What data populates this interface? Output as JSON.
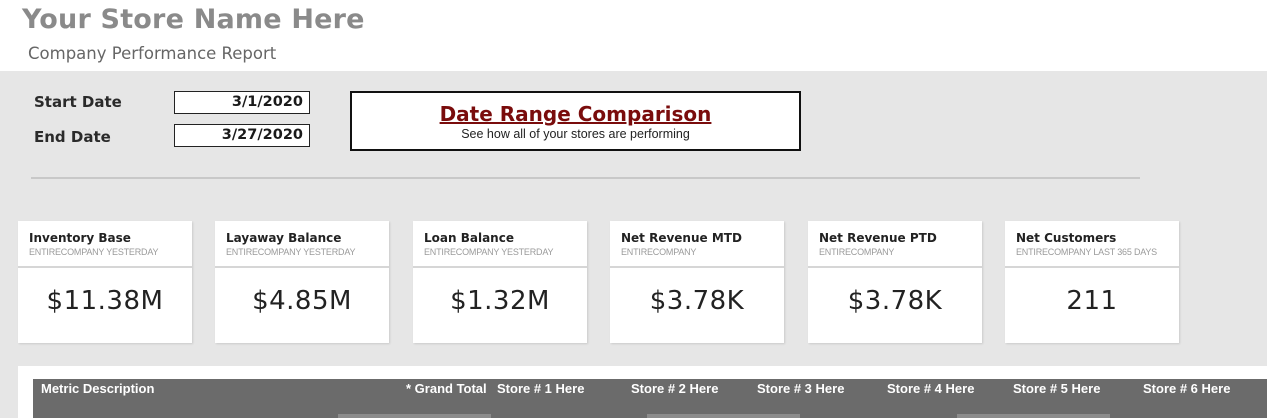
{
  "header": {
    "store_name": "Your Store Name Here",
    "report_subtitle": "Company Performance Report"
  },
  "dates": {
    "start_label": "Start Date",
    "start_value": "3/1/2020",
    "end_label": "End Date",
    "end_value": "3/27/2020"
  },
  "comparison": {
    "title": "Date Range Comparison",
    "subtitle": "See how all of your stores are performing"
  },
  "kpis": [
    {
      "title": "Inventory Base",
      "sub": "ENTIRECOMPANY YESTERDAY",
      "value": "$11.38M"
    },
    {
      "title": "Layaway Balance",
      "sub": "ENTIRECOMPANY YESTERDAY",
      "value": "$4.85M"
    },
    {
      "title": "Loan Balance",
      "sub": "ENTIRECOMPANY YESTERDAY",
      "value": "$1.32M"
    },
    {
      "title": "Net Revenue MTD",
      "sub": "ENTIRECOMPANY",
      "value": "$3.78K"
    },
    {
      "title": "Net Revenue PTD",
      "sub": "ENTIRECOMPANY",
      "value": "$3.78K"
    },
    {
      "title": "Net Customers",
      "sub": "ENTIRECOMPANY LAST 365 DAYS",
      "value": "211"
    }
  ],
  "table": {
    "columns": [
      "Metric Description",
      "* Grand Total",
      "Store # 1 Here",
      "Store # 2 Here",
      "Store # 3 Here",
      "Store # 4 Here",
      "Store # 5 Here",
      "Store # 6 Here"
    ]
  },
  "colors": {
    "title_gray": "#8a8a8a",
    "panel_bg": "#e6e6e6",
    "accent_red": "#7a0c0c",
    "table_header_bg": "#6b6b6b"
  }
}
